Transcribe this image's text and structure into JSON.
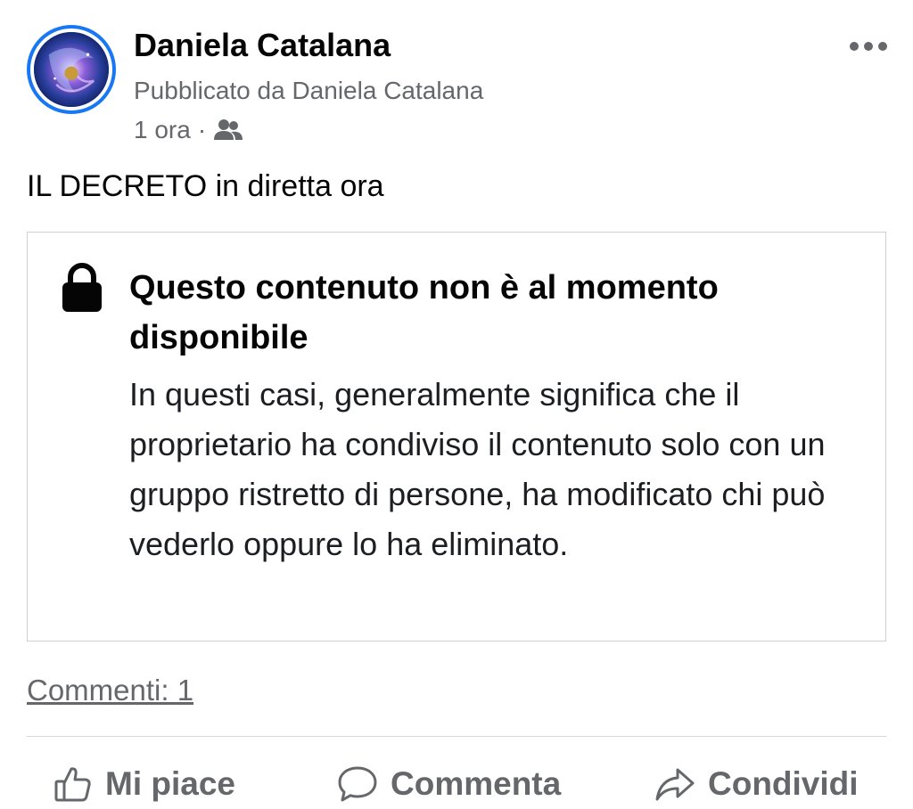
{
  "post": {
    "author": "Daniela Catalana",
    "posted_by": "Pubblicato da Daniela Catalana",
    "time": "1 ora",
    "separator": "·",
    "audience_icon": "friends-icon",
    "text": "IL DECRETO in diretta ora",
    "more_icon": "more-options-icon"
  },
  "unavailable": {
    "icon": "lock-icon",
    "title": "Questo contenuto non è al momento disponibile",
    "body": "In questi casi, generalmente significa che il proprietario ha condiviso il contenuto solo con un gruppo ristretto di persone, ha modificato chi può vederlo oppure lo ha eliminato."
  },
  "comments_link": "Commenti: 1",
  "actions": {
    "like": {
      "label": "Mi piace",
      "icon": "thumbs-up-icon"
    },
    "comment": {
      "label": "Commenta",
      "icon": "comment-bubble-icon"
    },
    "share": {
      "label": "Condividi",
      "icon": "share-arrow-icon"
    }
  },
  "colors": {
    "secondary_text": "#65676b",
    "avatar_ring": "#1877f2",
    "border": "#cfd1d5"
  }
}
